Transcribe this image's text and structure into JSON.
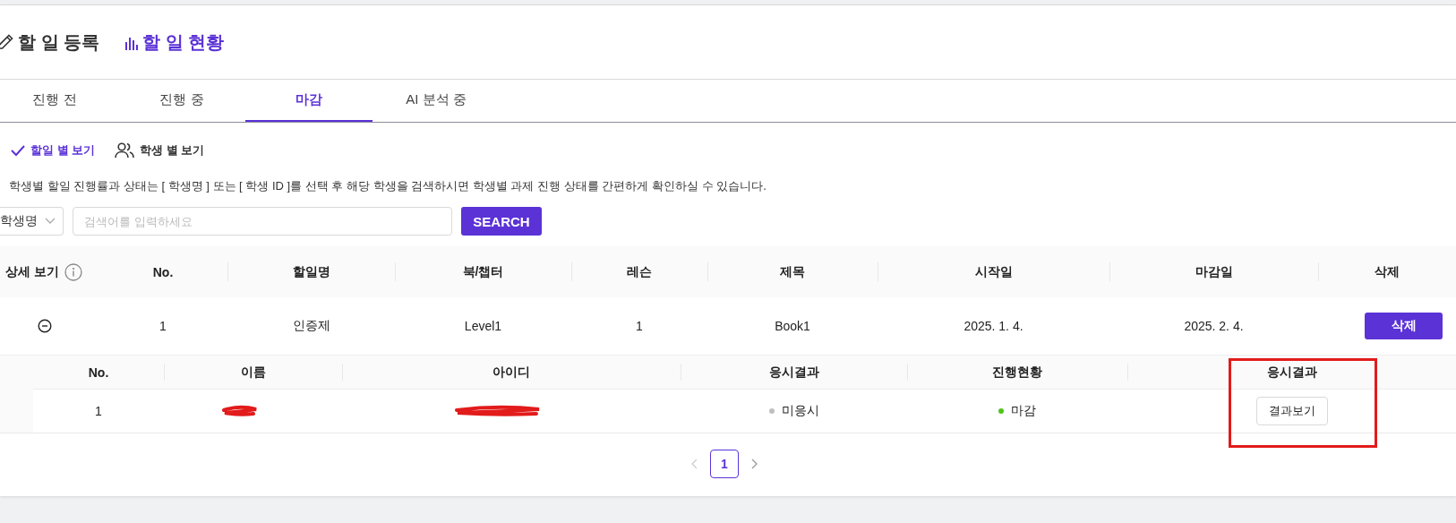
{
  "header": {
    "tabs": [
      {
        "label": "할 일 등록",
        "selected": false,
        "kind": "pencil"
      },
      {
        "label": "할 일 현황",
        "selected": true,
        "kind": "chart"
      }
    ]
  },
  "status_tabs": [
    {
      "label": "진행 전",
      "selected": false
    },
    {
      "label": "진행 중",
      "selected": false
    },
    {
      "label": "마감",
      "selected": true
    },
    {
      "label": "AI 분석 중",
      "selected": false
    }
  ],
  "view_toggle": [
    {
      "label": "할일 별 보기",
      "selected": true,
      "kind": "check"
    },
    {
      "label": "학생 별 보기",
      "selected": false,
      "kind": "users"
    }
  ],
  "description": "학생별 할일 진행률과 상태는 [ 학생명 ] 또는 [ 학생 ID ]를 선택 후 해당 학생을 검색하시면 학생별 과제 진행 상태를 간편하게 확인하실 수 있습니다.",
  "search": {
    "filter": "학생명",
    "placeholder": "검색어를 입력하세요",
    "button": "SEARCH"
  },
  "table": {
    "columns": [
      "상세 보기",
      "No.",
      "할일명",
      "북/챕터",
      "레슨",
      "제목",
      "시작일",
      "마감일",
      "삭제"
    ],
    "rows": [
      {
        "expanded": true,
        "cells": [
          "",
          "1",
          "인증제",
          "Level1",
          "1",
          "Book1",
          "2025. 1. 4.",
          "2025. 2. 4."
        ],
        "action": "삭제",
        "detail": {
          "columns": [
            {
              "label": "No.",
              "highlighted": false
            },
            {
              "label": "이름",
              "highlighted": false
            },
            {
              "label": "아이디",
              "highlighted": false
            },
            {
              "label": "응시결과",
              "highlighted": false
            },
            {
              "label": "진행현황",
              "highlighted": false
            },
            {
              "label": "응시결과",
              "highlighted": true
            }
          ],
          "rows": [
            {
              "no": "1",
              "name": {
                "kind": "redacted"
              },
              "id": {
                "kind": "redacted"
              },
              "result": {
                "label": "미응시",
                "color": "#bfbfbf"
              },
              "progress": {
                "label": "마감",
                "color": "#52c41a"
              },
              "action": "결과보기"
            }
          ]
        }
      }
    ]
  },
  "pagination": {
    "prev_disabled": true,
    "next_disabled": false,
    "pages": [
      {
        "label": "1",
        "selected": true
      }
    ]
  }
}
